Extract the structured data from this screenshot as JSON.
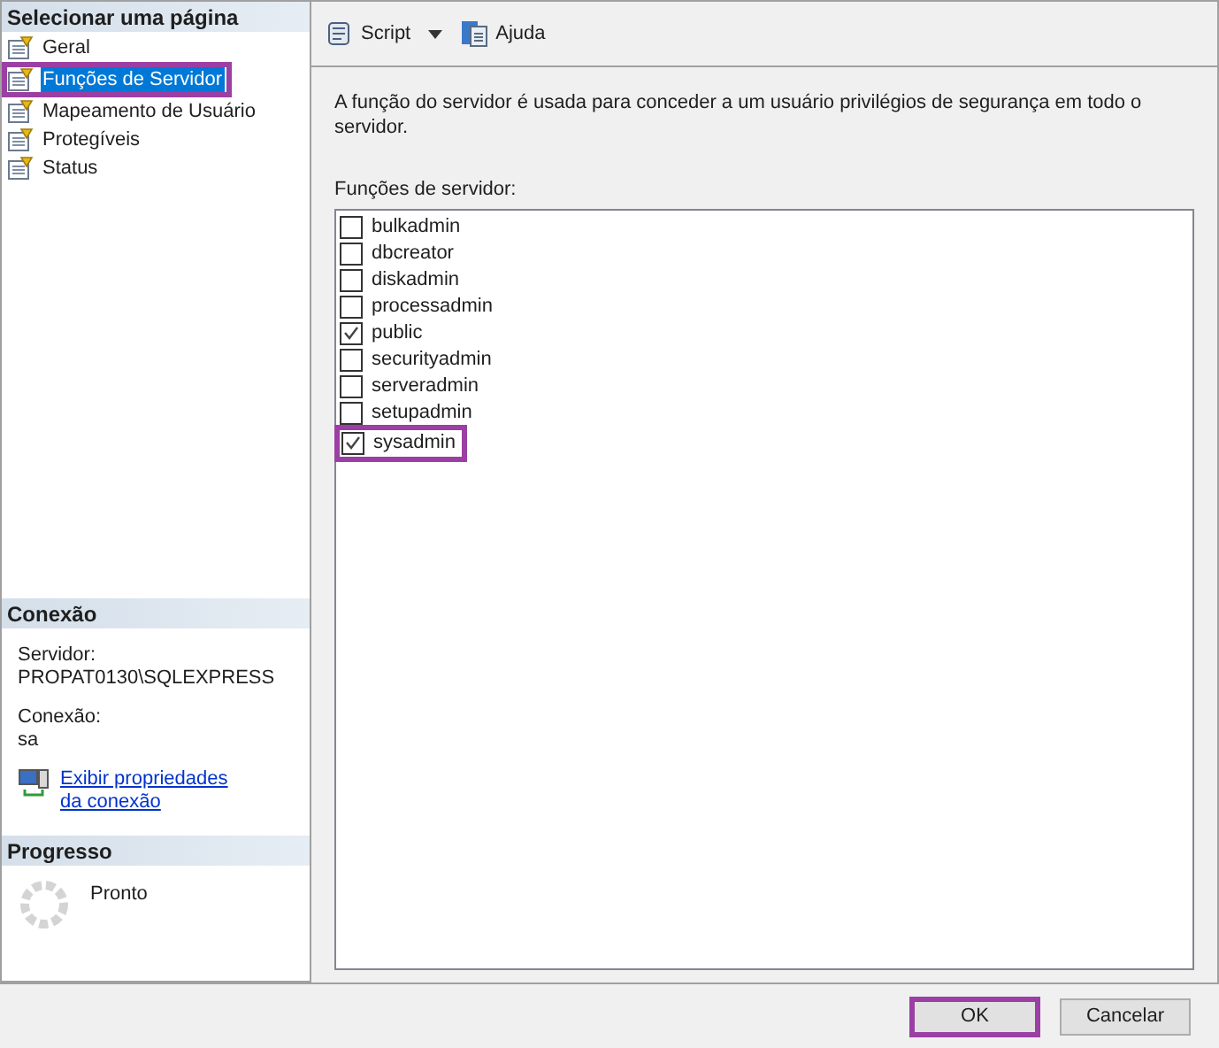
{
  "sidebar": {
    "title": "Selecionar uma página",
    "items": [
      {
        "label": "Geral",
        "selected": false,
        "highlighted": false
      },
      {
        "label": "Funções de Servidor",
        "selected": true,
        "highlighted": true
      },
      {
        "label": "Mapeamento de Usuário",
        "selected": false,
        "highlighted": false
      },
      {
        "label": "Protegíveis",
        "selected": false,
        "highlighted": false
      },
      {
        "label": "Status",
        "selected": false,
        "highlighted": false
      }
    ]
  },
  "connection": {
    "title": "Conexão",
    "server_label": "Servidor:",
    "server": "PROPAT0130\\SQLEXPRESS",
    "connection_label": "Conexão:",
    "connection": "sa",
    "link": "Exibir propriedades da conexão"
  },
  "progress": {
    "title": "Progresso",
    "status": "Pronto"
  },
  "toolbar": {
    "script": "Script",
    "help": "Ajuda"
  },
  "description": "A função do servidor é usada para conceder a um usuário privilégios de segurança em todo o servidor.",
  "roles_label": "Funções de servidor:",
  "roles": [
    {
      "label": "bulkadmin",
      "checked": false,
      "highlighted": false
    },
    {
      "label": "dbcreator",
      "checked": false,
      "highlighted": false
    },
    {
      "label": "diskadmin",
      "checked": false,
      "highlighted": false
    },
    {
      "label": "processadmin",
      "checked": false,
      "highlighted": false
    },
    {
      "label": "public",
      "checked": true,
      "highlighted": false
    },
    {
      "label": "securityadmin",
      "checked": false,
      "highlighted": false
    },
    {
      "label": "serveradmin",
      "checked": false,
      "highlighted": false
    },
    {
      "label": "setupadmin",
      "checked": false,
      "highlighted": false
    },
    {
      "label": "sysadmin",
      "checked": true,
      "highlighted": true
    }
  ],
  "buttons": [
    {
      "label": "OK",
      "highlighted": true
    },
    {
      "label": "Cancelar",
      "highlighted": false
    }
  ]
}
